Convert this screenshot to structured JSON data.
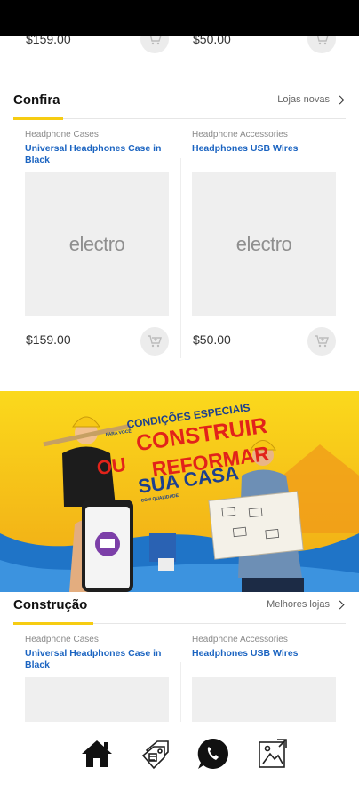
{
  "prev_row": {
    "left_price": "$159.00",
    "right_price": "$50.00"
  },
  "sections": [
    {
      "title": "Confira",
      "link_label": "Lojas novas",
      "products": [
        {
          "category": "Headphone Cases",
          "name": "Universal Headphones Case in Black",
          "image_text": "electro",
          "price": "$159.00"
        },
        {
          "category": "Headphone Accessories",
          "name": "Headphones USB Wires",
          "image_text": "electro",
          "price": "$50.00"
        }
      ]
    },
    {
      "title": "Construção",
      "link_label": "Melhores lojas",
      "products": [
        {
          "category": "Headphone Cases",
          "name": "Universal Headphones Case in Black"
        },
        {
          "category": "Headphone Accessories",
          "name": "Headphones USB Wires"
        }
      ]
    }
  ],
  "banner": {
    "line1": "CONDIÇÕES ESPECIAIS",
    "line2": "PARA VOCÊ",
    "line3": "CONSTRUIR",
    "line4": "OU",
    "line5": "REFORMAR",
    "line6": "SUA CASA",
    "line7": "COM QUALIDADE"
  },
  "bottom_nav": [
    "home-icon",
    "price-tags-icon",
    "whatsapp-icon",
    "gallery-icon"
  ],
  "colors": {
    "accent": "#f6cc12",
    "link": "#1b64c1",
    "banner_red": "#e2231a"
  }
}
